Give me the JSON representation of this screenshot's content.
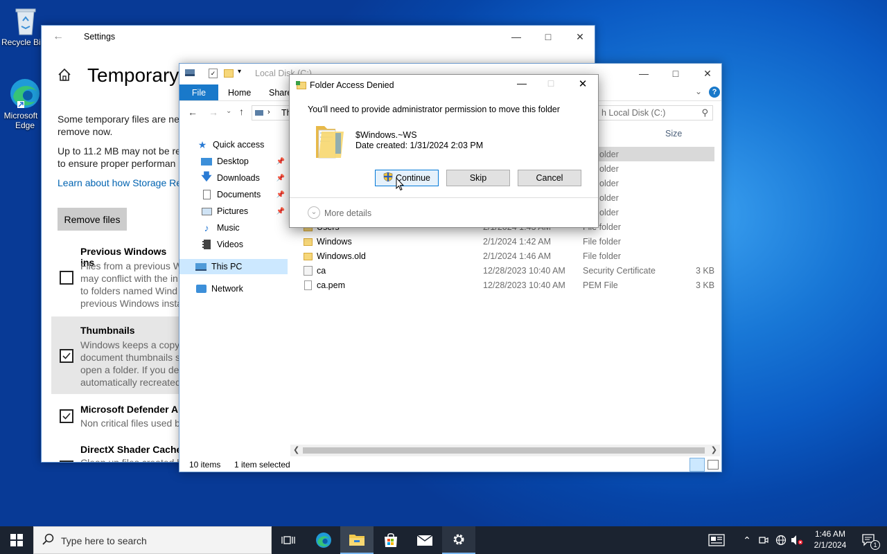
{
  "desktop": {
    "recycle_bin_label": "Recycle Bin",
    "edge_label_1": "Microsoft",
    "edge_label_2": "Edge"
  },
  "settings": {
    "title": "Settings",
    "page_title": "Temporary",
    "intro_line1": "Some temporary files are ne",
    "intro_line2": "remove now.",
    "warn_line1": "Up to 11.2 MB may not be re",
    "warn_line2": "to ensure proper performan",
    "learn_link": "Learn about how Storage Re",
    "remove_button": "Remove files",
    "items": [
      {
        "title": "Previous Windows ins",
        "lines": [
          "Files from a previous W",
          "may conflict with the in",
          "to folders named Wind",
          "previous Windows insta"
        ],
        "checked": false
      },
      {
        "title": "Thumbnails",
        "lines": [
          "Windows keeps a copy",
          "document thumbnails s",
          "open a folder. If you de",
          "automatically recreated"
        ],
        "checked": true
      },
      {
        "title": "Microsoft Defender A",
        "lines": [
          "Non critical files used b"
        ],
        "checked": true
      },
      {
        "title": "DirectX Shader Cache",
        "lines": [
          "Clean up files created b"
        ],
        "checked": true
      }
    ]
  },
  "explorer": {
    "title": "Local Disk (C:)",
    "ribbon_tabs": [
      "File",
      "Home",
      "Share"
    ],
    "address_crumb": "Th",
    "search_placeholder": "h Local Disk (C:)",
    "col_size": "Size",
    "nav": [
      {
        "label": "Quick access",
        "icon": "star-icon"
      },
      {
        "label": "Desktop",
        "icon": "desktop-icon",
        "pinned": true
      },
      {
        "label": "Downloads",
        "icon": "download-icon",
        "pinned": true
      },
      {
        "label": "Documents",
        "icon": "documents-icon",
        "pinned": true
      },
      {
        "label": "Pictures",
        "icon": "pictures-icon",
        "pinned": true
      },
      {
        "label": "Music",
        "icon": "music-icon"
      },
      {
        "label": "Videos",
        "icon": "videos-icon"
      },
      {
        "label": "This PC",
        "icon": "computer-icon"
      },
      {
        "label": "Network",
        "icon": "network-icon"
      }
    ],
    "hidden_types": [
      "older",
      "older",
      "older",
      "older",
      "older"
    ],
    "files": [
      {
        "name": "Users",
        "date": "2/1/2024 1:43 AM",
        "type": "File folder",
        "size": "",
        "icon": "folder"
      },
      {
        "name": "Windows",
        "date": "2/1/2024 1:42 AM",
        "type": "File folder",
        "size": "",
        "icon": "folder"
      },
      {
        "name": "Windows.old",
        "date": "2/1/2024 1:46 AM",
        "type": "File folder",
        "size": "",
        "icon": "folder"
      },
      {
        "name": "ca",
        "date": "12/28/2023 10:40 AM",
        "type": "Security Certificate",
        "size": "3 KB",
        "icon": "cert"
      },
      {
        "name": "ca.pem",
        "date": "12/28/2023 10:40 AM",
        "type": "PEM File",
        "size": "3 KB",
        "icon": "file"
      }
    ],
    "status_items": "10 items",
    "status_selected": "1 item selected"
  },
  "dialog": {
    "title": "Folder Access Denied",
    "message": "You'll need to provide administrator permission to move this folder",
    "folder_name": "$Windows.~WS",
    "date_created": "Date created: 1/31/2024 2:03 PM",
    "continue_label": "Continue",
    "skip_label": "Skip",
    "cancel_label": "Cancel",
    "more_details": "More details"
  },
  "taskbar": {
    "search_placeholder": "Type here to search",
    "time": "1:46 AM",
    "date": "2/1/2024",
    "notification_count": "1"
  }
}
